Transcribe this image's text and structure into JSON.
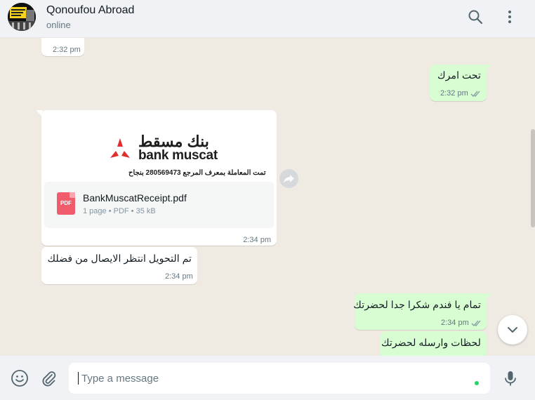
{
  "header": {
    "contact_name": "Qonoufou Abroad",
    "status": "online",
    "avatar_icon": "company-logo",
    "icons": [
      "search-icon",
      "menu-icon"
    ]
  },
  "messages": [
    {
      "direction": "in",
      "time": "2:32 pm"
    },
    {
      "direction": "out",
      "text": "تحت امرك",
      "time": "2:32 pm",
      "read": true
    },
    {
      "direction": "in",
      "type": "document",
      "preview": {
        "brand_arabic": "بنك مسقط",
        "brand_latin": "bank muscat",
        "reference_line": "تمت المعاملة بمعرف المرجع 280569473 بنجاح"
      },
      "file_name": "BankMuscatReceipt.pdf",
      "file_meta": "1 page • PDF • 35 kB",
      "file_badge": "PDF",
      "time": "2:34 pm"
    },
    {
      "direction": "in",
      "text": "تم التحويل انتظر الايصال من فضلك",
      "time": "2:34 pm"
    },
    {
      "direction": "out",
      "text": "تمام يا فندم شكرا جدا لحضرتك",
      "time": "2:34 pm",
      "read": true
    },
    {
      "direction": "out",
      "text": "لحظات وارسله لحضرتك"
    }
  ],
  "composer": {
    "placeholder": "Type a message",
    "icons": [
      "emoji-icon",
      "attach-icon",
      "microphone-icon"
    ]
  },
  "colors": {
    "chat_bg": "#efeae2",
    "outgoing_bubble": "#d9fdd3",
    "incoming_bubble": "#ffffff",
    "read_ticks": "#8696a0",
    "bank_red": "#e02d2d"
  }
}
